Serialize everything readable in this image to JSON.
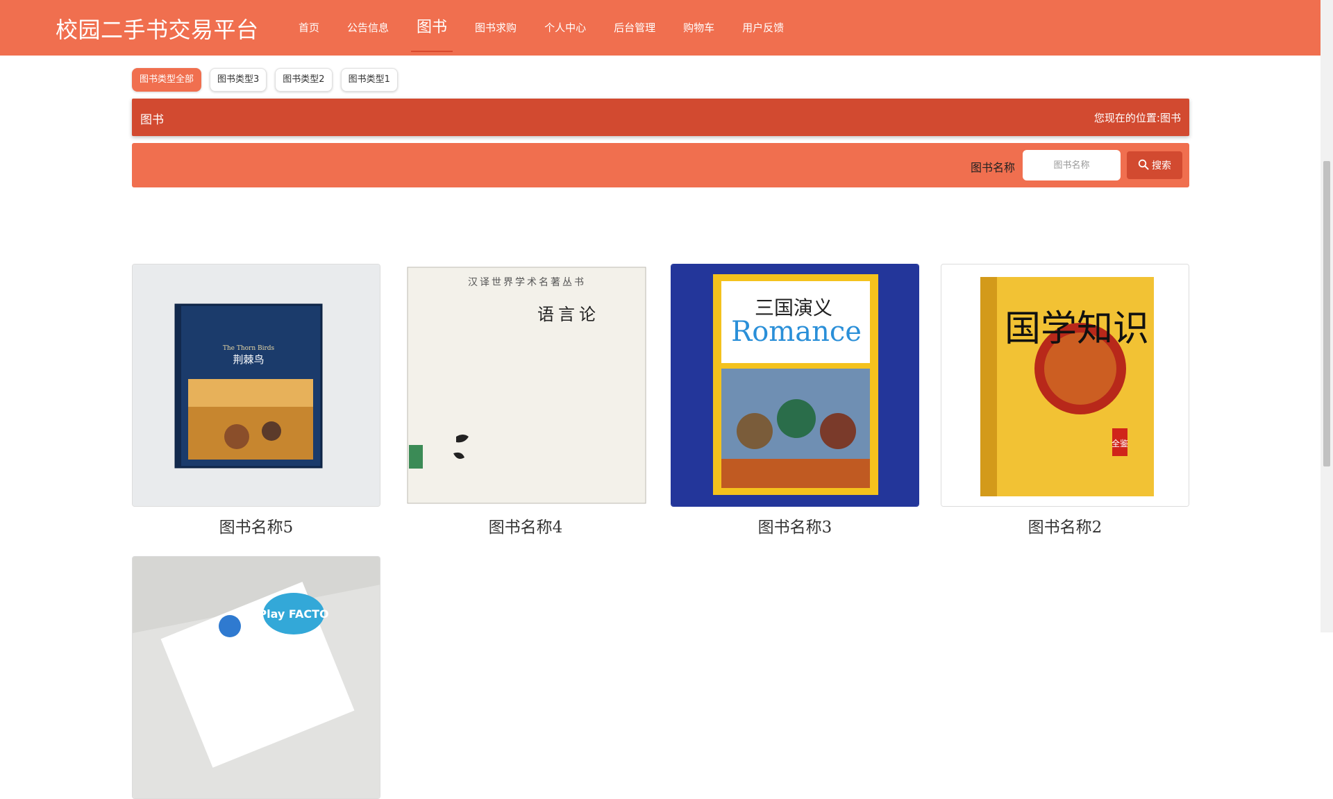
{
  "header": {
    "brand": "校园二手书交易平台",
    "nav": [
      {
        "label": "首页",
        "active": false
      },
      {
        "label": "公告信息",
        "active": false
      },
      {
        "label": "图书",
        "active": true
      },
      {
        "label": "图书求购",
        "active": false
      },
      {
        "label": "个人中心",
        "active": false
      },
      {
        "label": "后台管理",
        "active": false
      },
      {
        "label": "购物车",
        "active": false
      },
      {
        "label": "用户反馈",
        "active": false
      }
    ]
  },
  "categories": [
    {
      "label": "图书类型全部",
      "active": true
    },
    {
      "label": "图书类型3",
      "active": false
    },
    {
      "label": "图书类型2",
      "active": false
    },
    {
      "label": "图书类型1",
      "active": false
    }
  ],
  "location_bar": {
    "title": "图书",
    "prefix": "您现在的位置:",
    "current": "图书"
  },
  "search": {
    "label": "图书名称",
    "placeholder": "图书名称",
    "button_label": "搜索",
    "button_icon": "search-icon"
  },
  "books": [
    {
      "name": "图书名称5",
      "cover_title": "荆棘鸟",
      "cover_subtitle": "The Thorn Birds"
    },
    {
      "name": "图书名称4",
      "cover_title": "语言论",
      "cover_subtitle": "汉译世界学术名著丛书"
    },
    {
      "name": "图书名称3",
      "cover_title": "三国演义",
      "cover_subtitle": "Romance"
    },
    {
      "name": "图书名称2",
      "cover_title": "国学知识",
      "cover_subtitle": "全鉴"
    },
    {
      "name": "",
      "cover_title": "Play FACTO",
      "cover_subtitle": ""
    }
  ],
  "colors": {
    "primary": "#f06f4f",
    "dark_accent": "#d24a30"
  }
}
